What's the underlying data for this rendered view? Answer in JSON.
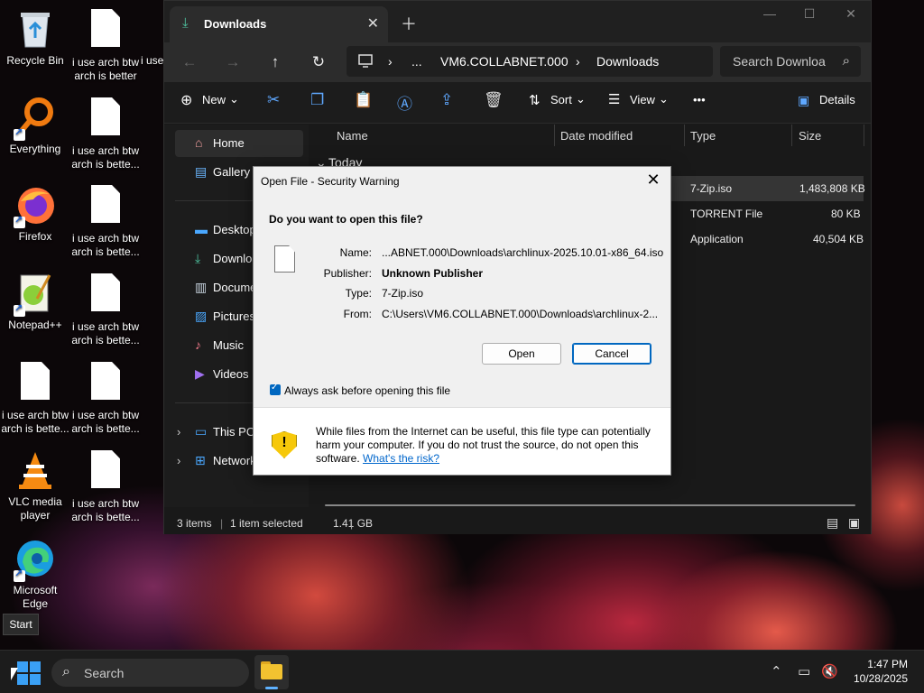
{
  "desktop": {
    "icons": [
      {
        "label": "Recycle Bin"
      },
      {
        "label": "Everything"
      },
      {
        "label": "Firefox"
      },
      {
        "label": "Notepad++"
      },
      {
        "label": "i use arch btw arch is bette..."
      },
      {
        "label": "VLC media player"
      },
      {
        "label": "Microsoft Edge"
      },
      {
        "label": "i use arch btw arch is better"
      },
      {
        "label": "i use arch btw arch is bette..."
      },
      {
        "label": "i use arch btw arch is bette..."
      },
      {
        "label": "i use arch btw arch is bette..."
      },
      {
        "label": "i use arch btw arch is bette..."
      },
      {
        "label": "i use arch btw arch is bette..."
      },
      {
        "label": "i use arch"
      }
    ]
  },
  "explorer": {
    "tab_title": "Downloads",
    "tab_icon": "download-icon",
    "address": {
      "computer_icon": "monitor-icon",
      "ellipsis": "...",
      "segments": [
        "VM6.COLLABNET.000",
        "Downloads"
      ]
    },
    "search_placeholder": "Search Downloa",
    "toolbar": {
      "new_label": "New",
      "sort_label": "Sort",
      "view_label": "View",
      "more": "•••",
      "details_label": "Details"
    },
    "sidebar": {
      "items": [
        {
          "label": "Home",
          "icon": "home-icon"
        },
        {
          "label": "Gallery",
          "icon": "gallery-icon"
        },
        {
          "label": "Desktop",
          "icon": "desktop-icon"
        },
        {
          "label": "Downloads",
          "icon": "download-icon"
        },
        {
          "label": "Documents",
          "icon": "documents-icon"
        },
        {
          "label": "Pictures",
          "icon": "pictures-icon"
        },
        {
          "label": "Music",
          "icon": "music-icon"
        },
        {
          "label": "Videos",
          "icon": "videos-icon"
        },
        {
          "label": "This PC",
          "icon": "this-pc-icon"
        },
        {
          "label": "Network",
          "icon": "network-icon"
        }
      ]
    },
    "columns": [
      "Name",
      "Date modified",
      "Type",
      "Size"
    ],
    "group_label": "Today",
    "rows": [
      {
        "type": "7-Zip.iso",
        "size": "1,483,808 KB"
      },
      {
        "type": "TORRENT File",
        "size": "80 KB"
      },
      {
        "type": "Application",
        "size": "40,504 KB"
      }
    ],
    "status": {
      "count": "3 items",
      "selected": "1 item selected",
      "size": "1.41 GB"
    }
  },
  "dialog": {
    "title": "Open File - Security Warning",
    "question": "Do you want to open this file?",
    "fields": [
      {
        "label": "Name:",
        "value": "...ABNET.000\\Downloads\\archlinux-2025.10.01-x86_64.iso"
      },
      {
        "label": "Publisher:",
        "value": "Unknown Publisher"
      },
      {
        "label": "Type:",
        "value": "7-Zip.iso"
      },
      {
        "label": "From:",
        "value": "C:\\Users\\VM6.COLLABNET.000\\Downloads\\archlinux-2..."
      }
    ],
    "open_label": "Open",
    "cancel_label": "Cancel",
    "checkbox_label": "Always ask before opening this file",
    "checkbox_checked": true,
    "warning_text": "While files from the Internet can be useful, this file type can potentially harm your computer. If you do not trust the source, do not open this software.",
    "risk_link": "What's the risk?"
  },
  "start_tooltip": "Start",
  "taskbar": {
    "search_label": "Search",
    "time": "1:47 PM",
    "date": "10/28/2025"
  },
  "colors": {
    "accent": "#0067c0",
    "shield": "#f6c80a"
  }
}
